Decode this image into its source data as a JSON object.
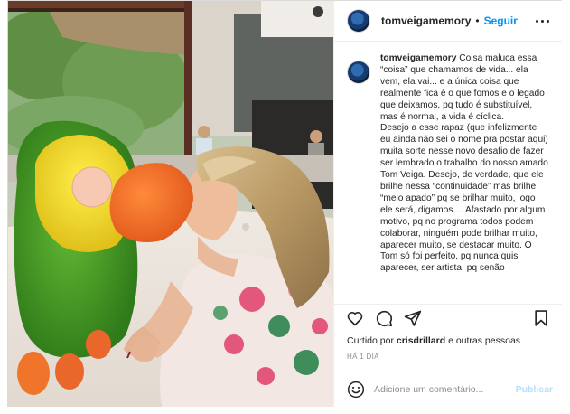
{
  "photo": {
    "alt": "Mulher beijando boneco de papagaio verde e amarelo"
  },
  "post": {
    "username": "tomveigamemory",
    "separator": "•",
    "follow_label": "Seguir",
    "more_icon": "more-options-icon"
  },
  "caption": {
    "username": "tomveigamemory",
    "paragraph1": "Coisa maluca essa “coisa” que chamamos de vida... ela vem, ela vai... e a única coisa que realmente fica é o que fomos e o legado que deixamos, pq tudo é substituível, mas é normal, a vida é cíclica.",
    "paragraph2": "Desejo a esse rapaz (que infelizmente eu ainda não sei o nome pra postar aqui) muita sorte nesse novo desafio de fazer ser lembrado o trabalho do nosso amado Tom Veiga. Desejo, de verdade, que ele brilhe nessa “continuidade” mas brilhe “meio apado” pq se brilhar muito, logo ele será, digamos.... Afastado por algum motivo, pq no programa todos podem colaborar, ninguém pode brilhar muito, aparecer muito, se destacar muito. O Tom só foi perfeito, pq nunca quis aparecer, ser artista, pq senão"
  },
  "actions": {
    "like_icon": "heart-icon",
    "comment_icon": "comment-icon",
    "share_icon": "share-icon",
    "save_icon": "bookmark-icon"
  },
  "likes": {
    "prefix": "Curtido por",
    "user": "crisdrillard",
    "suffix": "e outras pessoas"
  },
  "timestamp": "HÁ 1 DIA",
  "comment": {
    "emoji_icon": "emoji-icon",
    "placeholder": "Adicione um comentário...",
    "post_label": "Publicar"
  },
  "colors": {
    "accent": "#0095f6",
    "post_disabled": "#b2dffc",
    "secondary_text": "#8e8e8e",
    "border": "#dbdbdb"
  }
}
